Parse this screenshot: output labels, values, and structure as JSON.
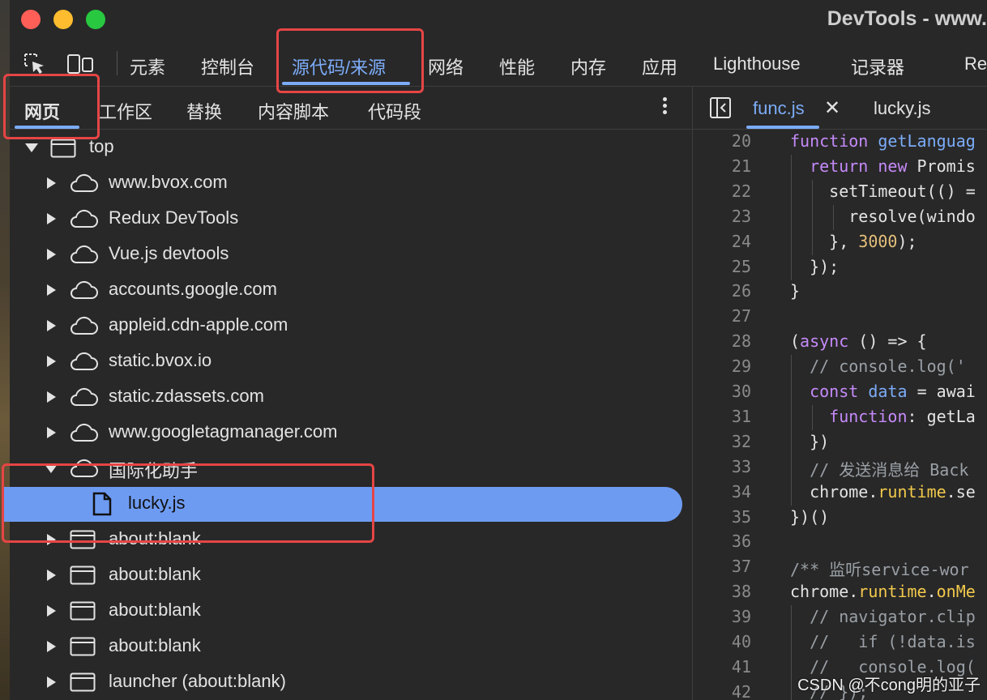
{
  "window": {
    "title": "DevTools - www."
  },
  "toolbar": {
    "tabs": [
      "元素",
      "控制台",
      "源代码/来源",
      "网络",
      "性能",
      "内存",
      "应用",
      "Lighthouse",
      "记录器",
      "Re"
    ],
    "active_index": 2
  },
  "left_panel": {
    "tabs": [
      "网页",
      "工作区",
      "替换",
      "内容脚本",
      "代码段"
    ],
    "active_index": 0,
    "tree": [
      {
        "label": "top",
        "expanded": true,
        "icon": "frame-icon"
      },
      {
        "label": "www.bvox.com",
        "expanded": false,
        "icon": "cloud-icon"
      },
      {
        "label": "Redux DevTools",
        "expanded": false,
        "icon": "cloud-icon"
      },
      {
        "label": "Vue.js devtools",
        "expanded": false,
        "icon": "cloud-icon"
      },
      {
        "label": "accounts.google.com",
        "expanded": false,
        "icon": "cloud-icon"
      },
      {
        "label": "appleid.cdn-apple.com",
        "expanded": false,
        "icon": "cloud-icon"
      },
      {
        "label": "static.bvox.io",
        "expanded": false,
        "icon": "cloud-icon"
      },
      {
        "label": "static.zdassets.com",
        "expanded": false,
        "icon": "cloud-icon"
      },
      {
        "label": "www.googletagmanager.com",
        "expanded": false,
        "icon": "cloud-icon"
      },
      {
        "label": "国际化助手",
        "expanded": true,
        "icon": "cloud-icon"
      },
      {
        "label": "lucky.js",
        "selected": true,
        "icon": "file-icon"
      },
      {
        "label": "about:blank",
        "expanded": false,
        "icon": "frame-icon"
      },
      {
        "label": "about:blank",
        "expanded": false,
        "icon": "frame-icon"
      },
      {
        "label": "about:blank",
        "expanded": false,
        "icon": "frame-icon"
      },
      {
        "label": "about:blank",
        "expanded": false,
        "icon": "frame-icon"
      },
      {
        "label": "launcher (about:blank)",
        "expanded": false,
        "icon": "frame-icon"
      }
    ]
  },
  "editor": {
    "tabs": [
      {
        "label": "func.js",
        "active": true
      },
      {
        "label": "lucky.js",
        "active": false
      }
    ],
    "lines": [
      {
        "n": "20",
        "code": "function getLanguag"
      },
      {
        "n": "21",
        "code": "  return new Promis"
      },
      {
        "n": "22",
        "code": "    setTimeout(() ="
      },
      {
        "n": "23",
        "code": "      resolve(windo"
      },
      {
        "n": "24",
        "code": "    }, 3000);"
      },
      {
        "n": "25",
        "code": "  });"
      },
      {
        "n": "26",
        "code": "}"
      },
      {
        "n": "27",
        "code": ""
      },
      {
        "n": "28",
        "code": "(async () => {"
      },
      {
        "n": "29",
        "code": "  // console.log('"
      },
      {
        "n": "30",
        "code": "  const data = awai"
      },
      {
        "n": "31",
        "code": "    function: getLa"
      },
      {
        "n": "32",
        "code": "  })"
      },
      {
        "n": "33",
        "code": "  // 发送消息给 Back"
      },
      {
        "n": "34",
        "code": "  chrome.runtime.se"
      },
      {
        "n": "35",
        "code": "})()"
      },
      {
        "n": "36",
        "code": ""
      },
      {
        "n": "37",
        "code": "/** 监听service-wor"
      },
      {
        "n": "38",
        "code": "chrome.runtime.onMe"
      },
      {
        "n": "39",
        "code": "  // navigator.clip"
      },
      {
        "n": "40",
        "code": "  //   if (!data.is"
      },
      {
        "n": "41",
        "code": "  //   console.log("
      },
      {
        "n": "42",
        "code": "  // });"
      }
    ]
  },
  "watermark": "CSDN @不cong明的亚子",
  "colors": {
    "accent": "#7cacf8",
    "selection": "#6e9bf2",
    "annotation": "#e64545"
  }
}
